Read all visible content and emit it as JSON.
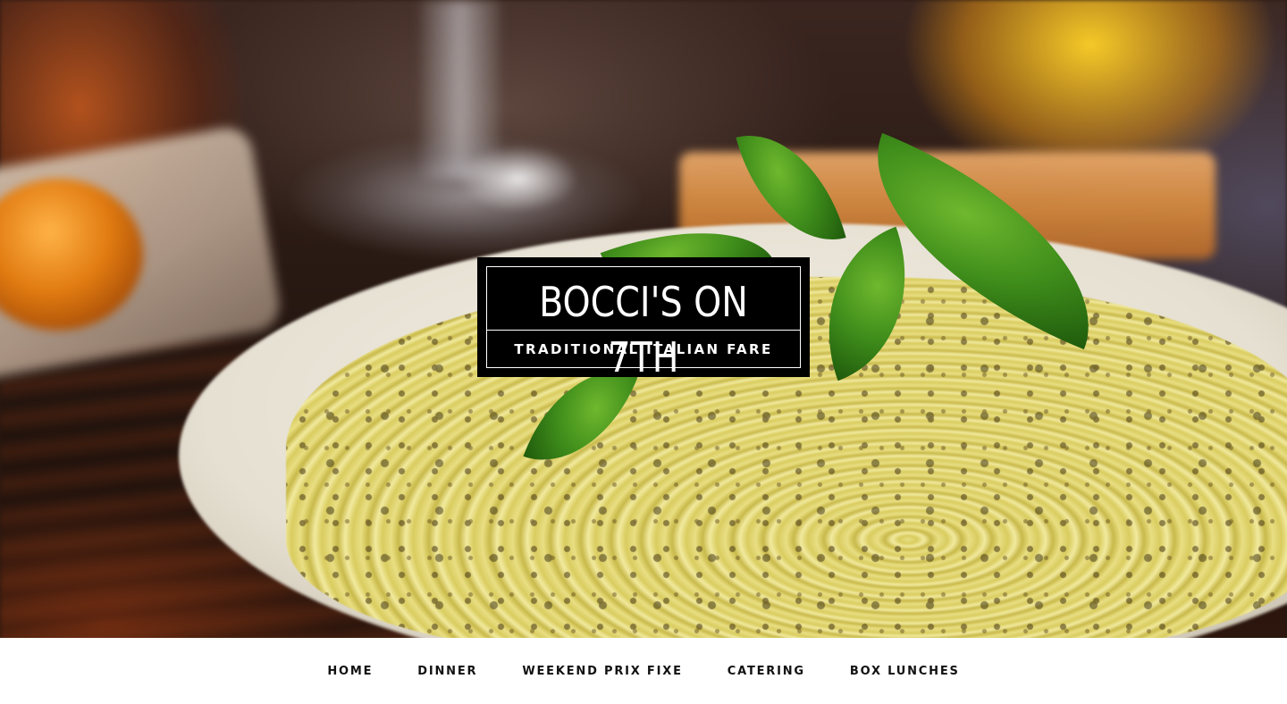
{
  "site": {
    "title": "BOCCI'S ON 7TH",
    "tagline": "TRADITIONAL ITALIAN FARE"
  },
  "hero": {
    "image_subject": "pesto-fettuccine-with-basil"
  },
  "nav": {
    "items": [
      {
        "label": "HOME"
      },
      {
        "label": "DINNER"
      },
      {
        "label": "WEEKEND PRIX FIXE"
      },
      {
        "label": "CATERING"
      },
      {
        "label": "BOX LUNCHES"
      }
    ]
  },
  "colors": {
    "logo_background": "#000000",
    "logo_text": "#ffffff",
    "nav_background": "#ffffff",
    "nav_text": "#111111"
  }
}
